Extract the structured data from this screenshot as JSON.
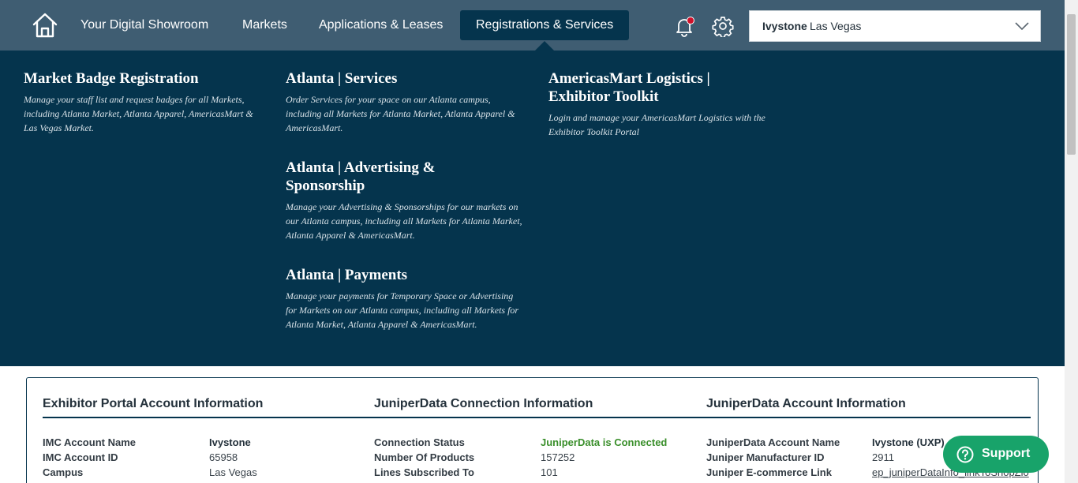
{
  "nav": {
    "items": [
      {
        "label": "Your Digital Showroom"
      },
      {
        "label": "Markets"
      },
      {
        "label": "Applications & Leases"
      },
      {
        "label": "Registrations & Services"
      }
    ],
    "active_index": 3
  },
  "account_selector": {
    "name": "Ivystone",
    "location": "Las Vegas"
  },
  "menu": {
    "market_badge": {
      "title": "Market Badge Registration",
      "description": "Manage your staff list and request badges for all Markets, including Atlanta Market, Atlanta Apparel, AmericasMart & Las Vegas Market."
    },
    "atlanta_services": {
      "title": "Atlanta | Services",
      "description": "Order Services for your space on our Atlanta campus, including all Markets for Atlanta Market, Atlanta Apparel & AmericasMart."
    },
    "atlanta_advertising": {
      "title": "Atlanta | Advertising & Sponsorship",
      "description": "Manage your Advertising & Sponsorships for our markets on our Atlanta campus, including all Markets for Atlanta Market, Atlanta Apparel & AmericasMart."
    },
    "atlanta_payments": {
      "title": "Atlanta | Payments",
      "description": "Manage your payments for Temporary Space or Advertising for Markets on our Atlanta campus, including all Markets for Atlanta Market, Atlanta Apparel & AmericasMart."
    },
    "logistics": {
      "title": "AmericasMart Logistics | Exhibitor Toolkit",
      "description": "Login and manage your AmericasMart Logistics with the Exhibitor Toolkit Portal"
    }
  },
  "panel": {
    "exhibitor": {
      "title": "Exhibitor Portal Account Information",
      "rows": [
        {
          "label": "IMC Account Name",
          "value": "Ivystone"
        },
        {
          "label": "IMC Account ID",
          "value": "65958"
        },
        {
          "label": "Campus",
          "value": "Las Vegas"
        }
      ]
    },
    "connection": {
      "title": "JuniperData Connection Information",
      "rows": [
        {
          "label": "Connection Status",
          "value": "JuniperData is Connected"
        },
        {
          "label": "Number Of Products",
          "value": "157252"
        },
        {
          "label": "Lines Subscribed To",
          "value": "101"
        }
      ]
    },
    "juniper_account": {
      "title": "JuniperData Account Information",
      "rows": [
        {
          "label": "JuniperData Account Name",
          "value": "Ivystone (UXP)"
        },
        {
          "label": "Juniper Manufacturer ID",
          "value": "2911"
        },
        {
          "label": "Juniper E-commerce Link",
          "value": "ep_juniperDataInfo_linkToShopZio"
        }
      ]
    }
  },
  "support": {
    "label": "Support"
  },
  "colors": {
    "nav_bg": "#3f5d72",
    "menu_bg": "#05344d",
    "connected_green": "#3a8f2b",
    "support_green": "#18a36a",
    "notification_red": "#d0112b"
  },
  "icons": [
    "home-icon",
    "bell-icon",
    "gear-icon",
    "chevron-down-icon",
    "help-icon"
  ]
}
